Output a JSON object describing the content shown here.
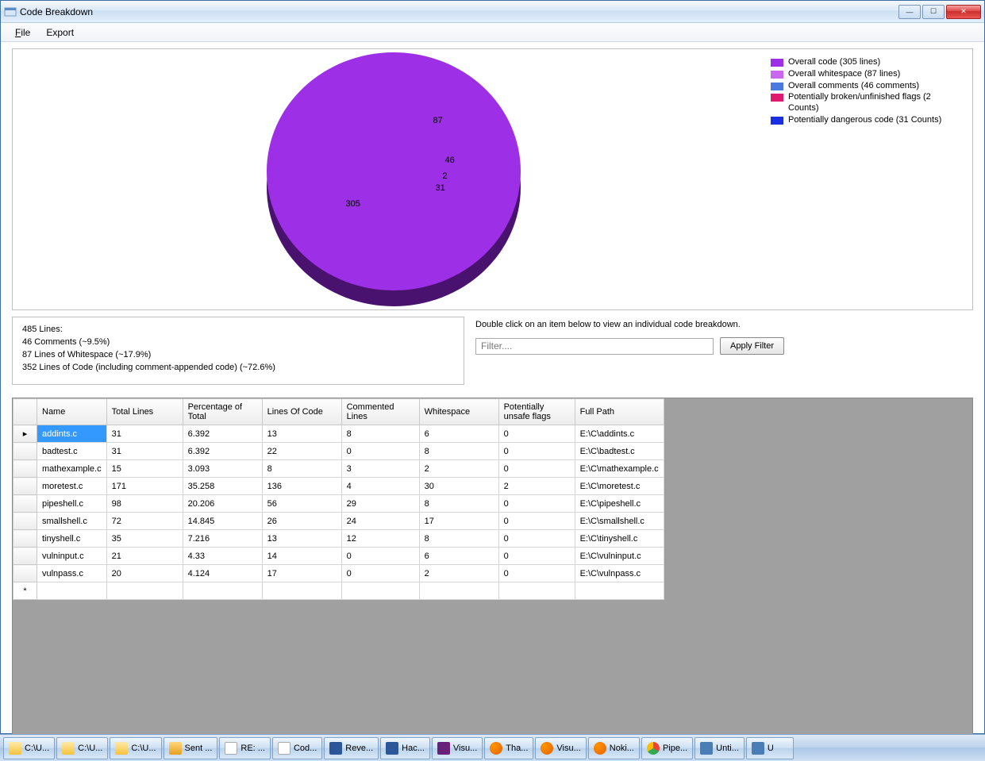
{
  "window": {
    "title": "Code Breakdown"
  },
  "menu": {
    "file": "File",
    "file_u": "F",
    "export": "Export"
  },
  "chart_data": {
    "type": "pie",
    "title": "",
    "series": [
      {
        "name": "Overall code (305 lines)",
        "value": 305,
        "color": "#9d2fe6",
        "label": "305"
      },
      {
        "name": "Overall whitespace (87 lines)",
        "value": 87,
        "color": "#c967ef",
        "label": "87"
      },
      {
        "name": "Overall comments (46 comments)",
        "value": 46,
        "color": "#4a7ae0",
        "label": "46"
      },
      {
        "name": "Potentially broken/unfinished flags (2 Counts)",
        "value": 2,
        "color": "#e01b6e",
        "label": "2"
      },
      {
        "name": "Potentially dangerous code (31 Counts)",
        "value": 31,
        "color": "#1a2fe0",
        "label": "31"
      }
    ]
  },
  "legend": [
    {
      "color": "#9d2fe6",
      "text": "Overall code (305 lines)"
    },
    {
      "color": "#c967ef",
      "text": "Overall whitespace (87 lines)"
    },
    {
      "color": "#4a7ae0",
      "text": "Overall comments (46 comments)"
    },
    {
      "color": "#e01b6e",
      "text": "Potentially broken/unfinished flags (2 Counts)"
    },
    {
      "color": "#1a2fe0",
      "text": "Potentially dangerous code (31 Counts)"
    }
  ],
  "summary": {
    "l1": "485 Lines:",
    "l2": "46 Comments (~9.5%)",
    "l3": "87 Lines of Whitespace (~17.9%)",
    "l4": "352 Lines of Code (including comment-appended code) (~72.6%)"
  },
  "filter": {
    "hint": "Double click on an item below to view an individual code breakdown.",
    "placeholder": "Filter....",
    "apply": "Apply Filter"
  },
  "columns": {
    "name": "Name",
    "total": "Total Lines",
    "pct": "Percentage of Total",
    "loc": "Lines Of Code",
    "cmt": "Commented Lines",
    "ws": "Whitespace",
    "flags": "Potentially unsafe flags",
    "path": "Full Path"
  },
  "rows": [
    {
      "name": "addints.c",
      "total": "31",
      "pct": "6.392",
      "loc": "13",
      "cmt": "8",
      "ws": "6",
      "flags": "0",
      "path": "E:\\C\\addints.c",
      "selected": true
    },
    {
      "name": "badtest.c",
      "total": "31",
      "pct": "6.392",
      "loc": "22",
      "cmt": "0",
      "ws": "8",
      "flags": "0",
      "path": "E:\\C\\badtest.c"
    },
    {
      "name": "mathexample.c",
      "total": "15",
      "pct": "3.093",
      "loc": "8",
      "cmt": "3",
      "ws": "2",
      "flags": "0",
      "path": "E:\\C\\mathexample.c"
    },
    {
      "name": "moretest.c",
      "total": "171",
      "pct": "35.258",
      "loc": "136",
      "cmt": "4",
      "ws": "30",
      "flags": "2",
      "path": "E:\\C\\moretest.c"
    },
    {
      "name": "pipeshell.c",
      "total": "98",
      "pct": "20.206",
      "loc": "56",
      "cmt": "29",
      "ws": "8",
      "flags": "0",
      "path": "E:\\C\\pipeshell.c"
    },
    {
      "name": "smallshell.c",
      "total": "72",
      "pct": "14.845",
      "loc": "26",
      "cmt": "24",
      "ws": "17",
      "flags": "0",
      "path": "E:\\C\\smallshell.c"
    },
    {
      "name": "tinyshell.c",
      "total": "35",
      "pct": "7.216",
      "loc": "13",
      "cmt": "12",
      "ws": "8",
      "flags": "0",
      "path": "E:\\C\\tinyshell.c"
    },
    {
      "name": "vulninput.c",
      "total": "21",
      "pct": "4.33",
      "loc": "14",
      "cmt": "0",
      "ws": "6",
      "flags": "0",
      "path": "E:\\C\\vulninput.c"
    },
    {
      "name": "vulnpass.c",
      "total": "20",
      "pct": "4.124",
      "loc": "17",
      "cmt": "0",
      "ws": "2",
      "flags": "0",
      "path": "E:\\C\\vulnpass.c"
    }
  ],
  "taskbar": [
    {
      "icon": "folder-ico",
      "label": "C:\\U..."
    },
    {
      "icon": "folder-ico",
      "label": "C:\\U..."
    },
    {
      "icon": "folder-ico",
      "label": "C:\\U..."
    },
    {
      "icon": "outlook-ico",
      "label": "Sent ..."
    },
    {
      "icon": "doc-ico",
      "label": "RE: ..."
    },
    {
      "icon": "doc-ico",
      "label": "Cod..."
    },
    {
      "icon": "word-ico",
      "label": "Reve..."
    },
    {
      "icon": "word-ico",
      "label": "Hac..."
    },
    {
      "icon": "vs-ico",
      "label": "Visu..."
    },
    {
      "icon": "ff-ico",
      "label": "Tha..."
    },
    {
      "icon": "ff-ico",
      "label": "Visu..."
    },
    {
      "icon": "ff-ico",
      "label": "Noki..."
    },
    {
      "icon": "chrome-ico",
      "label": "Pipe..."
    },
    {
      "icon": "generic-ico",
      "label": "Unti..."
    },
    {
      "icon": "generic-ico",
      "label": "U"
    }
  ]
}
